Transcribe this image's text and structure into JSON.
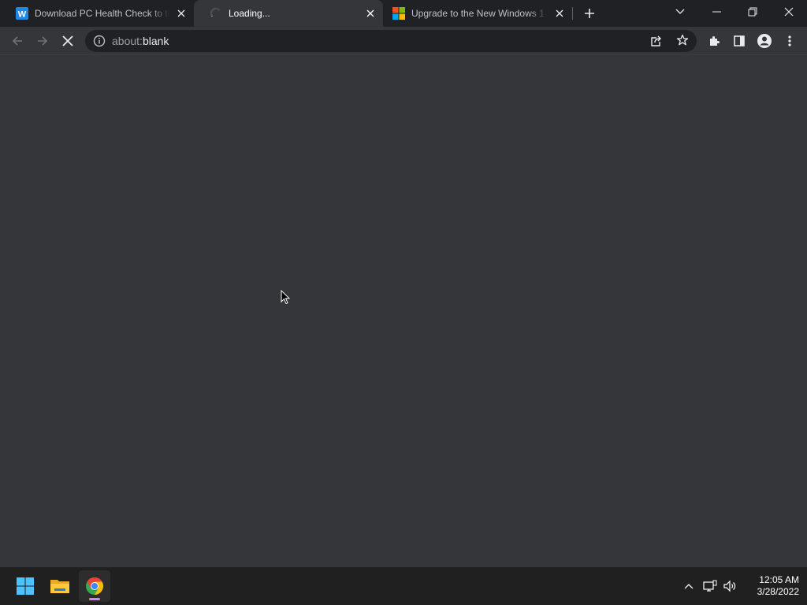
{
  "browser": {
    "tabs": [
      {
        "title": "Download PC Health Check to te",
        "favicon": "word-w-icon",
        "active": false
      },
      {
        "title": "Loading...",
        "favicon": "loading-spinner-icon",
        "active": true
      },
      {
        "title": "Upgrade to the New Windows 1",
        "favicon": "microsoft-logo-icon",
        "active": false
      }
    ],
    "new_tab_label": "+",
    "address": {
      "scheme": "about:",
      "path": "blank"
    },
    "colors": {
      "frame": "#202124",
      "toolbar": "#35363a",
      "accent": "#8ab4f8"
    }
  },
  "taskbar": {
    "apps": [
      "windows-start-icon",
      "file-explorer-icon",
      "chrome-icon"
    ],
    "clock": {
      "time": "12:05 AM",
      "date": "3/28/2022"
    }
  }
}
